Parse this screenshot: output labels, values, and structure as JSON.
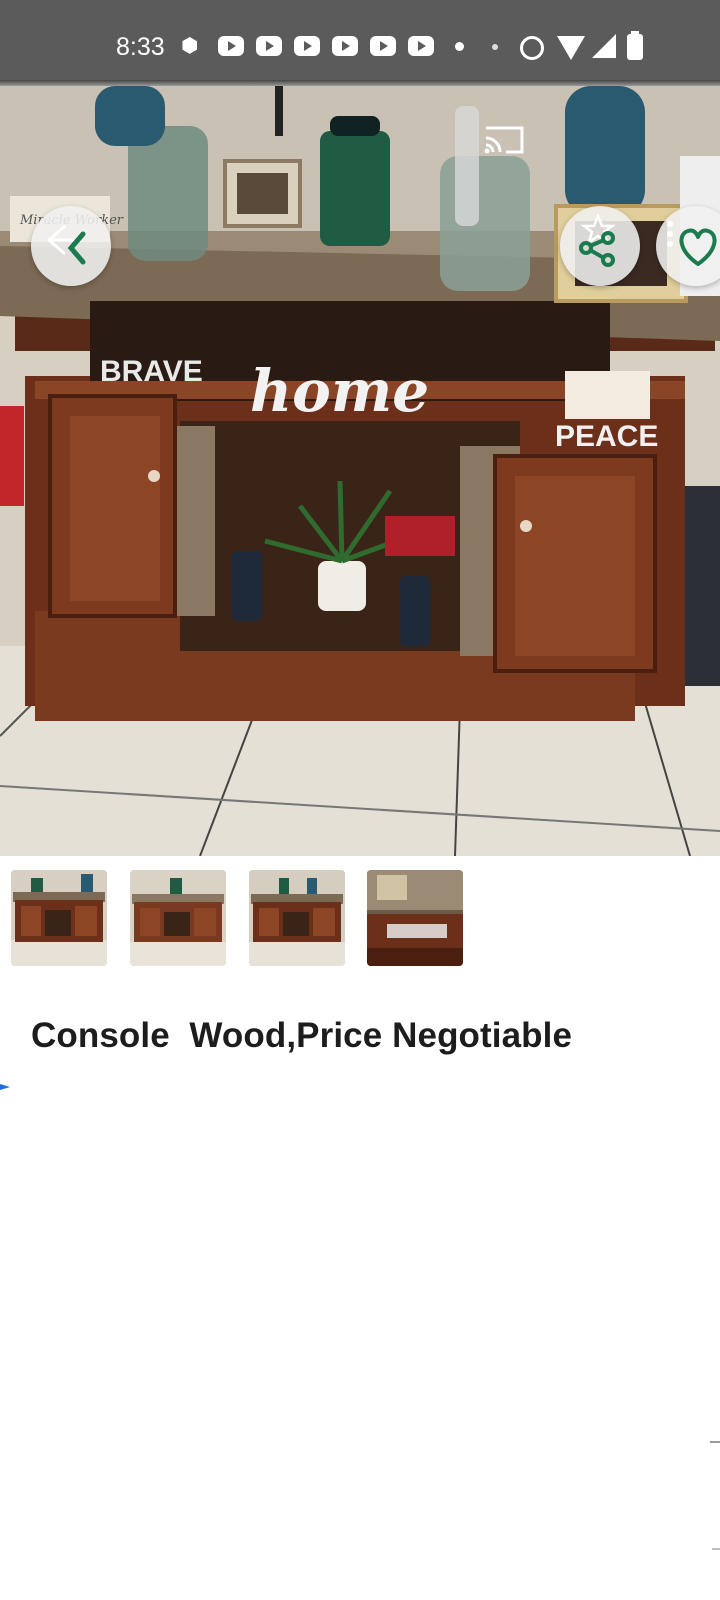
{
  "status_bar": {
    "time": "8:33",
    "icons": [
      "android-icon",
      "youtube-icon",
      "youtube-icon",
      "youtube-icon",
      "youtube-icon",
      "youtube-icon",
      "youtube-icon",
      "dot-icon",
      "dot-icon",
      "alarm-icon",
      "wifi-icon",
      "signal-icon",
      "battery-icon"
    ]
  },
  "photo": {
    "description_words": {
      "brave": "BRAVE",
      "home": "home",
      "peace": "PEACE",
      "sign": "Miracle Worker"
    }
  },
  "overlay_buttons": {
    "back": "back-arrow-icon",
    "cast": "cast-icon",
    "star": "star-icon",
    "share": "share-icon",
    "favorite": "heart-icon",
    "menu": "more-vert-icon"
  },
  "thumbnails": [
    {
      "name": "thumbnail-1"
    },
    {
      "name": "thumbnail-2"
    },
    {
      "name": "thumbnail-3"
    },
    {
      "name": "thumbnail-4"
    }
  ],
  "listing": {
    "title": "Console  Wood,Price Negotiable"
  },
  "colors": {
    "status_bar": "#5b5b5b",
    "accent_green": "#1b7a4e",
    "title_text": "#1d1d1d"
  }
}
